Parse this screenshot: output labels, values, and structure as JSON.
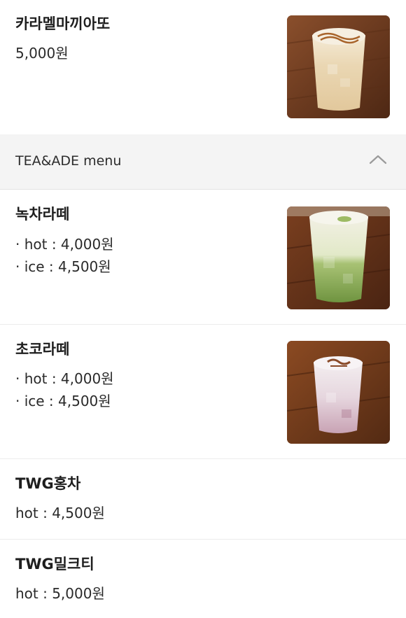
{
  "items_top": {
    "caramel": {
      "name": "카라멜마끼아또",
      "price": "5,000원"
    }
  },
  "section": {
    "title": "TEA&ADE menu",
    "toggle_icon": "chevron-up-icon"
  },
  "items": {
    "greentea": {
      "name": "녹차라떼",
      "hot": "· hot : 4,000원",
      "ice": "· ice : 4,500원"
    },
    "choco": {
      "name": "초코라떼",
      "hot": "· hot : 4,000원",
      "ice": "· ice : 4,500원"
    },
    "twg_tea": {
      "name": "TWG홍차",
      "price": "hot : 4,500원"
    },
    "twg_milktea": {
      "name": "TWG밀크티",
      "price": "hot : 5,000원"
    }
  },
  "colors": {
    "section_bg": "#f4f4f4",
    "divider": "#ececec",
    "text": "#222222"
  }
}
